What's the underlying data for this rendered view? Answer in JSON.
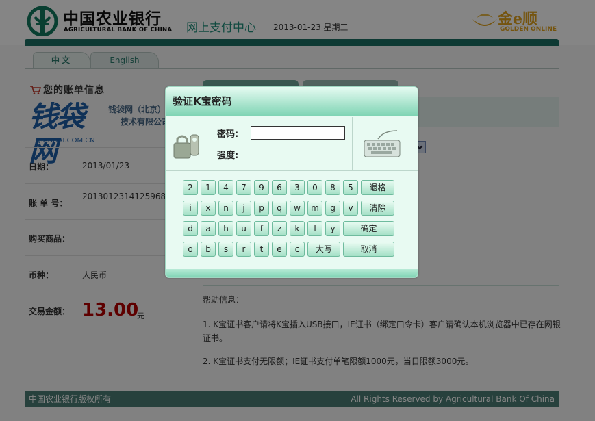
{
  "header": {
    "bank_name_cn": "中国农业银行",
    "bank_name_en": "AGRICULTURAL BANK OF CHINA",
    "center_title": "网上支付中心",
    "date": "2013-01-23 星期三",
    "partner_cn": "金e顺",
    "partner_en": "GOLDEN ONLINE"
  },
  "language_tabs": [
    {
      "label": "中文"
    },
    {
      "label": "English"
    }
  ],
  "bill": {
    "title": "您的账单信息",
    "merchant_logo": "钱袋网",
    "merchant_domain": "QIANDAI.COM.CN",
    "merchant_name": "钱袋网（北京）信息技术有限公司",
    "date_label": "日期：",
    "date_value": "2013/01/23",
    "order_label": "账 单 号：",
    "order_value": "201301231412596835",
    "goods_label": "购买商品：",
    "goods_value": "",
    "currency_label": "币种：",
    "currency_value": "人民币",
    "amount_label": "交易金额：",
    "amount_value": "13.00",
    "amount_unit": "元"
  },
  "help": {
    "title": "帮助信息：",
    "item1": "1. K宝证书客户请将K宝插入USB接口，IE证书（绑定口令卡）客户请确认本机浏览器中已存在网银证书。",
    "item2": "2. K宝证书支付无限额；IE证书支付单笔限额1000元，当日限额3000元。"
  },
  "footer": {
    "left": "中国农业银行版权所有",
    "right": "All Rights Reserved by Agricultural Bank Of China"
  },
  "dialog": {
    "title": "验证K宝密码",
    "password_label": "密码:",
    "strength_label": "强度:",
    "password_value": "",
    "keys": {
      "row1": [
        "2",
        "1",
        "4",
        "7",
        "9",
        "6",
        "3",
        "0",
        "8",
        "5"
      ],
      "row2": [
        "i",
        "x",
        "n",
        "j",
        "p",
        "q",
        "w",
        "m",
        "g",
        "v"
      ],
      "row3": [
        "d",
        "a",
        "h",
        "u",
        "f",
        "z",
        "k",
        "l",
        "y"
      ],
      "row4": [
        "o",
        "b",
        "s",
        "r",
        "t",
        "e",
        "c"
      ],
      "backspace": "退格",
      "clear": "清除",
      "confirm": "确定",
      "caps": "大写",
      "cancel": "取消"
    }
  }
}
